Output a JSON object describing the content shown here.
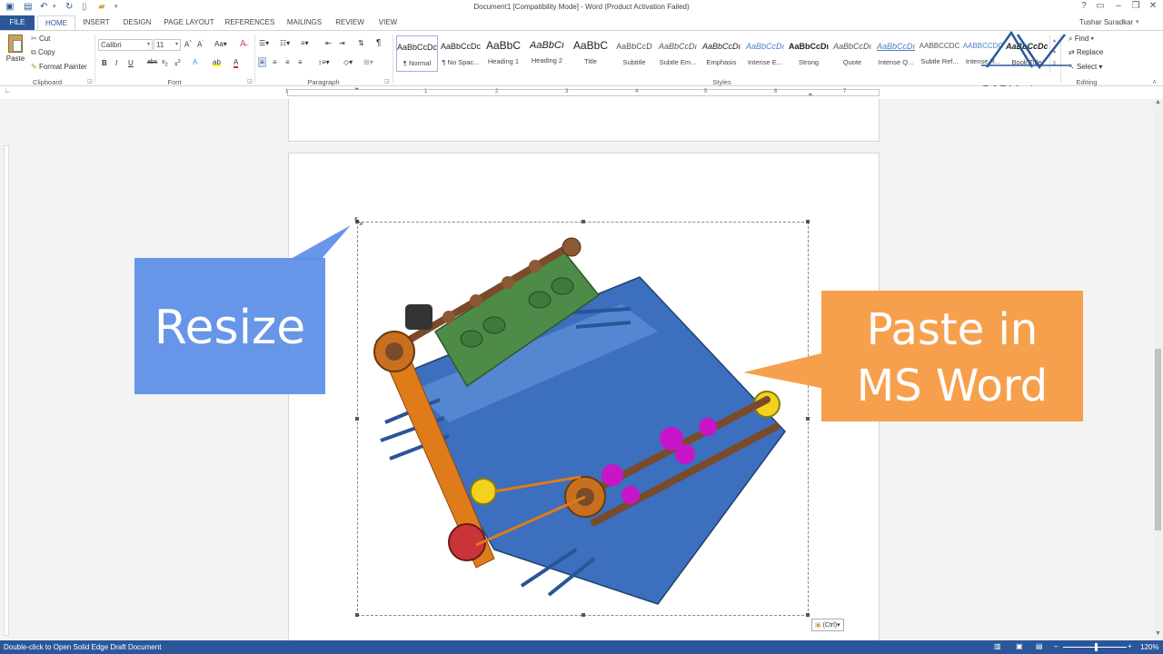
{
  "window": {
    "title": "Document1 [Compatibility Mode] - Word (Product Activation Failed)",
    "user": "Tushar Suradkar"
  },
  "tabs": [
    "FILE",
    "HOME",
    "INSERT",
    "DESIGN",
    "PAGE LAYOUT",
    "REFERENCES",
    "MAILINGS",
    "REVIEW",
    "VIEW"
  ],
  "clipboard": {
    "paste": "Paste",
    "cut": "Cut",
    "copy": "Copy",
    "format_painter": "Format Painter",
    "label": "Clipboard"
  },
  "font": {
    "name": "Calibri",
    "size": "11",
    "label": "Font"
  },
  "paragraph": {
    "label": "Paragraph"
  },
  "styles": {
    "label": "Styles",
    "items": [
      {
        "sample": "AaBbCcDc",
        "name": "¶ Normal"
      },
      {
        "sample": "AaBbCcDc",
        "name": "¶ No Spac..."
      },
      {
        "sample": "AaBbC",
        "name": "Heading 1"
      },
      {
        "sample": "AaBbCı",
        "name": "Heading 2"
      },
      {
        "sample": "AaBbC",
        "name": "Title"
      },
      {
        "sample": "AaBbCcD",
        "name": "Subtitle"
      },
      {
        "sample": "AaBbCcDı",
        "name": "Subtle Em..."
      },
      {
        "sample": "AaBbCcDı",
        "name": "Emphasis"
      },
      {
        "sample": "AaBbCcDı",
        "name": "Intense E..."
      },
      {
        "sample": "AaBbCcDı",
        "name": "Strong"
      },
      {
        "sample": "AaBbCcDı",
        "name": "Quote"
      },
      {
        "sample": "AaBbCcDı",
        "name": "Intense Q..."
      },
      {
        "sample": "AABBCCDC",
        "name": "Subtle Ref..."
      },
      {
        "sample": "AABBCCDC",
        "name": "Intense R..."
      },
      {
        "sample": "AaBbCcDc",
        "name": "Book Title"
      }
    ]
  },
  "editing": {
    "find": "Find",
    "replace": "Replace",
    "select": "Select",
    "label": "Editing"
  },
  "ruler": [
    "1",
    "1",
    "2",
    "3",
    "4",
    "5",
    "6",
    "7"
  ],
  "callouts": {
    "resize": "Resize",
    "paste_line1": "Paste in",
    "paste_line2": "MS Word"
  },
  "logo": {
    "text": "CADVertex"
  },
  "paste_options": "(Ctrl)",
  "status": {
    "message": "Double-click to Open Solid Edge Draft Document",
    "zoom": "120%"
  },
  "colors": {
    "accent": "#2b579a",
    "callout_blue": "#5b8de6",
    "callout_orange": "#f6a04d"
  }
}
